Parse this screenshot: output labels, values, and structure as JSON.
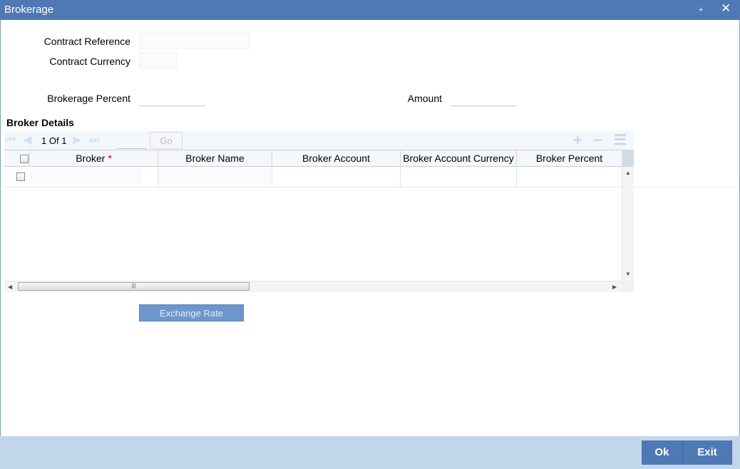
{
  "window": {
    "title": "Brokerage",
    "minimize_glyph": "▬",
    "close_glyph": "✕"
  },
  "form": {
    "contract_reference_label": "Contract Reference",
    "contract_reference_value": "",
    "contract_currency_label": "Contract Currency",
    "contract_currency_value": "",
    "brokerage_percent_label": "Brokerage Percent",
    "brokerage_percent_value": "",
    "amount_label": "Amount",
    "amount_value": ""
  },
  "broker_details": {
    "title": "Broker Details",
    "pagination": {
      "current": "1",
      "of_label": "Of",
      "total": "1",
      "page_input": "",
      "go_label": "Go"
    },
    "columns": {
      "broker": "Broker",
      "required_mark": "*",
      "broker_name": "Broker Name",
      "broker_account": "Broker Account",
      "broker_account_currency": "Broker Account Currency",
      "broker_percent": "Broker Percent"
    },
    "rows": [
      {
        "broker": "",
        "broker_name": "",
        "broker_account": "",
        "broker_account_currency": "",
        "broker_percent": ""
      }
    ]
  },
  "buttons": {
    "exchange_rate": "Exchange Rate",
    "ok": "Ok",
    "exit": "Exit"
  },
  "icons": {
    "first": "⏮",
    "prev": "◀",
    "next": "▶",
    "last": "⏭",
    "add": "+",
    "delete": "−",
    "view": "☰",
    "scroll_up": "▲",
    "scroll_down": "▼",
    "scroll_left": "◀",
    "scroll_right": "▶",
    "grip": "|||"
  },
  "colors": {
    "titlebar": "#4f78b4",
    "footer": "#c1d6ea",
    "button": "#4f79b5",
    "disabled_button": "#6e95cc"
  }
}
